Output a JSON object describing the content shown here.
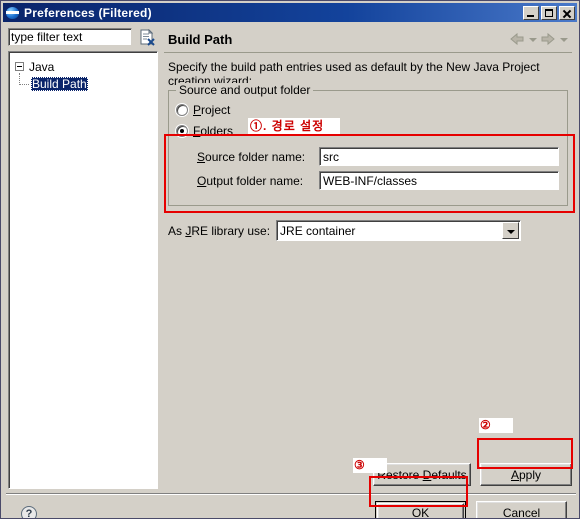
{
  "window": {
    "title": "Preferences  (Filtered)",
    "icon": "eclipse-sphere-icon",
    "buttons": {
      "minimize": "minimize-icon",
      "maximize": "maximize-icon",
      "close": "close-icon"
    }
  },
  "filter": {
    "value": "type filter text",
    "placeholder": "type filter text",
    "clear_icon": "clear-filter-icon"
  },
  "tree": {
    "root": {
      "label": "Java",
      "expanded": true
    },
    "child": {
      "label": "Build Path",
      "selected": true
    }
  },
  "page": {
    "title": "Build Path",
    "description": "Specify the build path entries used as default by the New Java Project creation wizard:",
    "nav": {
      "back_icon": "back-arrow-icon",
      "back_menu_icon": "chevron-down-icon",
      "forward_icon": "forward-arrow-icon",
      "forward_menu_icon": "chevron-down-icon"
    }
  },
  "group": {
    "legend": "Source and output folder",
    "radio_project": {
      "label": "Project",
      "mnemonic": "P",
      "checked": false
    },
    "radio_folders": {
      "label": "Folders",
      "mnemonic": "F",
      "checked": true
    },
    "source_folder": {
      "label_pre": "",
      "label": "Source folder name:",
      "mnemonic": "S",
      "value": "src"
    },
    "output_folder": {
      "label": "Output folder name:",
      "mnemonic": "O",
      "value": "WEB-INF/classes"
    }
  },
  "jre": {
    "label": "As JRE library use:",
    "mnemonic": "J",
    "value": "JRE container",
    "dropdown_icon": "chevron-down-icon"
  },
  "buttons": {
    "restore_defaults": "Restore Defaults",
    "restore_defaults_mnemonic": "D",
    "apply": "Apply",
    "apply_mnemonic": "A",
    "ok": "OK",
    "cancel": "Cancel",
    "help_icon": "help-question-icon",
    "help_glyph": "?"
  },
  "annotations": {
    "step1_text": "①. 경로 설정",
    "step2_text": "②",
    "step3_text": "③",
    "color": "#cc0000",
    "box_color": "#e60000"
  }
}
